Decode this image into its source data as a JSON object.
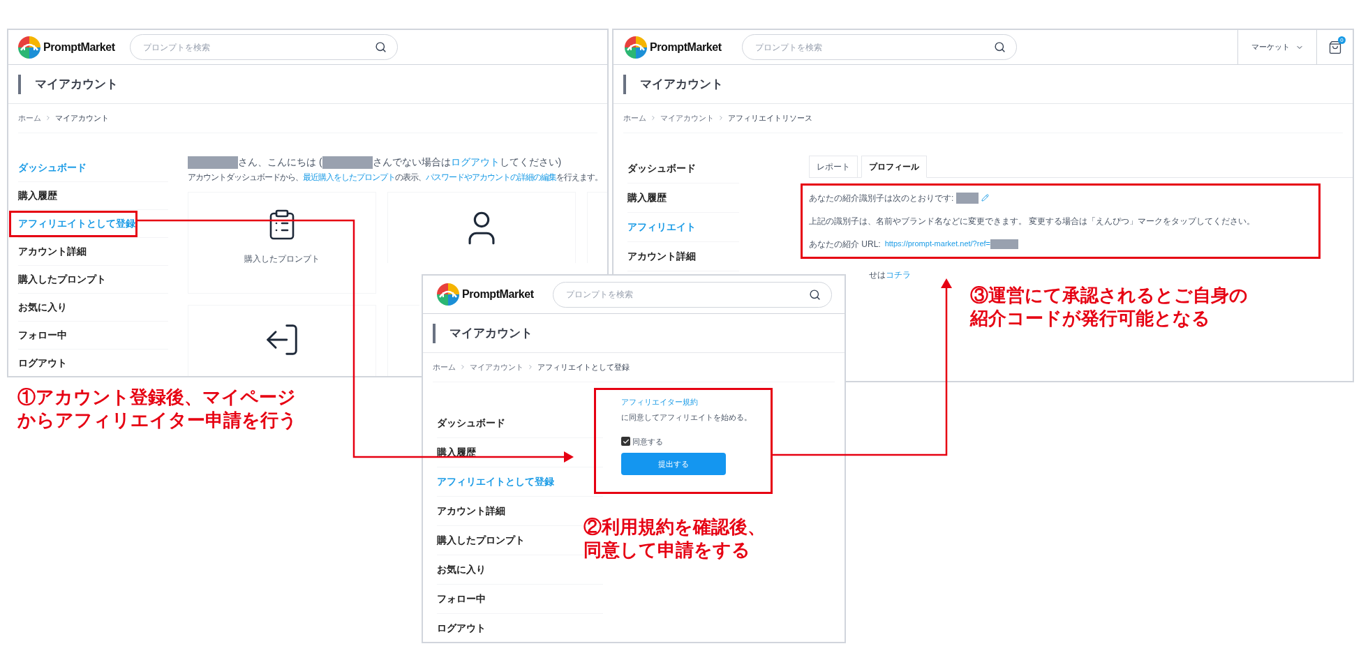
{
  "left_window": {
    "logo": "PromptMarket",
    "search": {
      "placeholder": "プロンプトを検索"
    },
    "page_title": "マイアカウント",
    "breadcrumb": [
      "ホーム",
      "マイアカウント"
    ],
    "sidebar": [
      {
        "label": "ダッシュボード",
        "selected": true,
        "highlighted": false
      },
      {
        "label": "購入履歴",
        "selected": false,
        "highlighted": false
      },
      {
        "label": "アフィリエイトとして登録",
        "selected": true,
        "highlighted": true
      },
      {
        "label": "アカウント詳細",
        "selected": false,
        "highlighted": false
      },
      {
        "label": "購入したプロンプト",
        "selected": false,
        "highlighted": false
      },
      {
        "label": "お気に入り",
        "selected": false,
        "highlighted": false
      },
      {
        "label": "フォロー中",
        "selected": false,
        "highlighted": false
      },
      {
        "label": "ログアウト",
        "selected": false,
        "highlighted": false
      }
    ],
    "greeting": [
      {
        "kind": "redacted"
      },
      {
        "kind": "text",
        "text": "さん、こんにちは ("
      },
      {
        "kind": "redacted"
      },
      {
        "kind": "text",
        "text": "さんでない場合は"
      },
      {
        "kind": "link",
        "text": "ログアウト"
      },
      {
        "kind": "text",
        "text": "してください)"
      }
    ],
    "intro": [
      {
        "kind": "text",
        "text": "アカウントダッシュボードから、"
      },
      {
        "kind": "link",
        "text": "最近購入をしたプロンプト"
      },
      {
        "kind": "text",
        "text": "の表示、"
      },
      {
        "kind": "link",
        "text": "パスワードやアカウントの詳細の編集"
      },
      {
        "kind": "text",
        "text": "を行えます。"
      }
    ],
    "cards": [
      {
        "kind": "clipboard",
        "label": "購入したプロンプト"
      },
      {
        "kind": "user"
      },
      {
        "kind": "empty"
      },
      {
        "kind": "exit"
      },
      {
        "kind": "empty"
      }
    ]
  },
  "right_window": {
    "logo": "PromptMarket",
    "search": {
      "placeholder": "プロンプトを検索"
    },
    "nav": "マーケット",
    "cart_count": "0",
    "page_title": "マイアカウント",
    "breadcrumb": [
      "ホーム",
      "マイアカウント",
      "アフィリエイトリソース"
    ],
    "sidebar": [
      {
        "label": "ダッシュボード",
        "selected": false
      },
      {
        "label": "購入履歴",
        "selected": false
      },
      {
        "label": "アフィリエイト",
        "selected": true
      },
      {
        "label": "アカウント詳細",
        "selected": false
      }
    ],
    "tabs": [
      {
        "label": "レポート",
        "selected": false
      },
      {
        "label": "プロフィール",
        "selected": true
      }
    ],
    "profile": {
      "highlighted": true,
      "id_line": "あなたの紹介識別子は次のとおりです:",
      "note": "上記の識別子は、名前やブランド名などに変更できます。 変更する場合は「えんぴつ」マークをタップしてください。",
      "url_label": "あなたの紹介 URL:",
      "url": "https://prompt-market.net/?ref="
    },
    "contact": {
      "text": "せは",
      "link": "コチラ"
    }
  },
  "middle_window": {
    "logo": "PromptMarket",
    "search": {
      "placeholder": "プロンプトを検索"
    },
    "page_title": "マイアカウント",
    "breadcrumb": [
      "ホーム",
      "マイアカウント",
      "アフィリエイトとして登録"
    ],
    "sidebar": [
      {
        "label": "ダッシュボード",
        "selected": false
      },
      {
        "label": "購入履歴",
        "selected": false
      },
      {
        "label": "アフィリエイトとして登録",
        "selected": true
      },
      {
        "label": "アカウント詳細",
        "selected": false
      },
      {
        "label": "購入したプロンプト",
        "selected": false
      },
      {
        "label": "お気に入り",
        "selected": false
      },
      {
        "label": "フォロー中",
        "selected": false
      },
      {
        "label": "ログアウト",
        "selected": false
      }
    ],
    "form": {
      "highlighted": true,
      "terms_link": "アフィリエイター規約",
      "terms_text": "に同意してアフィリエイトを始める。",
      "agree": {
        "label": "同意する",
        "checked": true
      },
      "submit": "提出する"
    }
  },
  "annotations": [
    {
      "lines": [
        "①アカウント登録後、マイページ",
        "からアフィリエイター申請を行う"
      ]
    },
    {
      "lines": [
        "②利用規約を確認後、",
        "同意して申請をする"
      ]
    },
    {
      "lines": [
        "③運営にて承認されるとご自身の",
        "紹介コードが発行可能となる"
      ]
    }
  ]
}
